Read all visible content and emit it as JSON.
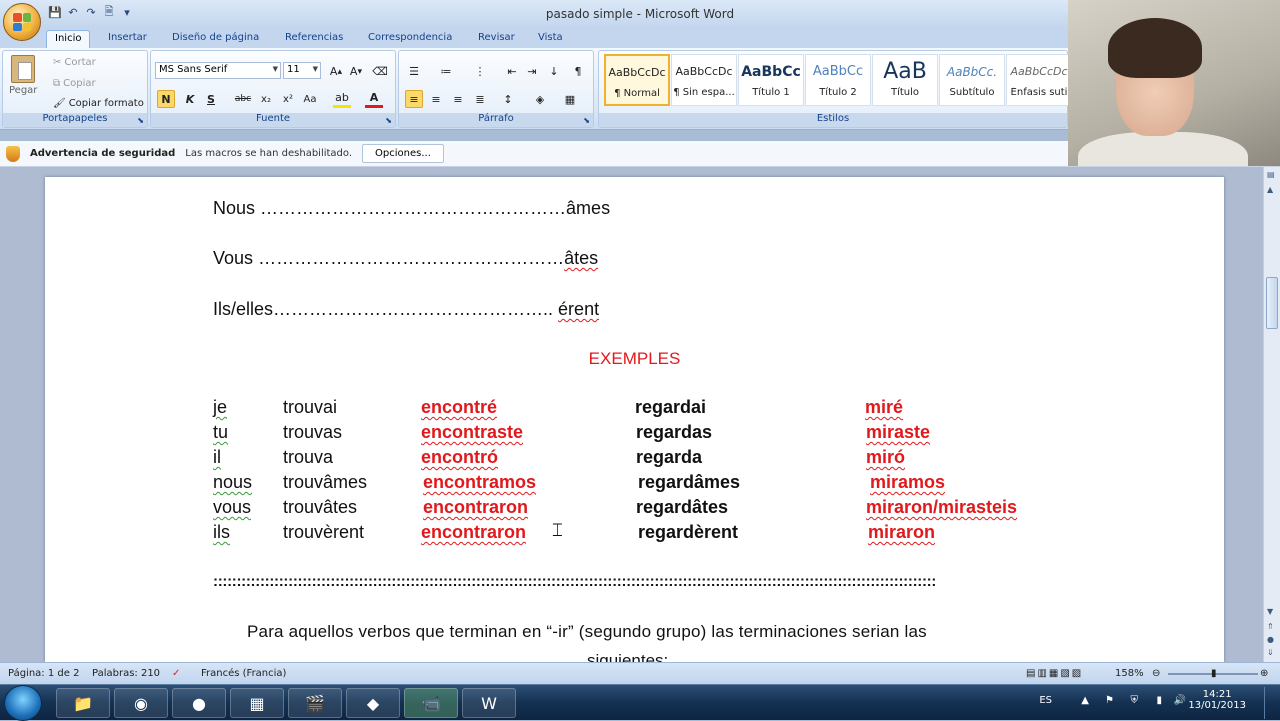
{
  "window": {
    "title": "pasado simple - Microsoft Word"
  },
  "tabs": [
    "Inicio",
    "Insertar",
    "Diseño de página",
    "Referencias",
    "Correspondencia",
    "Revisar",
    "Vista"
  ],
  "active_tab": "Inicio",
  "ribbon": {
    "clipboard": {
      "label": "Portapapeles",
      "paste": "Pegar",
      "cut": "Cortar",
      "copy": "Copiar",
      "format_painter": "Copiar formato"
    },
    "font": {
      "label": "Fuente",
      "font_name": "MS Sans Serif",
      "font_size": "11"
    },
    "paragraph": {
      "label": "Párrafo"
    },
    "styles": {
      "label": "Estilos",
      "items": [
        {
          "preview": "AaBbCcDc",
          "name": "¶ Normal"
        },
        {
          "preview": "AaBbCcDc",
          "name": "¶ Sin espa..."
        },
        {
          "preview": "AaBbCc",
          "name": "Título 1"
        },
        {
          "preview": "AaBbCc",
          "name": "Título 2"
        },
        {
          "preview": "AaB",
          "name": "Título"
        },
        {
          "preview": "AaBbCc.",
          "name": "Subtítulo"
        },
        {
          "preview": "AaBbCcDc",
          "name": "Énfasis suti"
        }
      ]
    }
  },
  "security_bar": {
    "title": "Advertencia de seguridad",
    "message": "Las macros se han deshabilitado.",
    "button": "Opciones..."
  },
  "document": {
    "lines": [
      {
        "pronoun": "Nous",
        "dots": "……………………………………………",
        "ending": "âmes"
      },
      {
        "pronoun": "Vous",
        "dots": "……………………………………………",
        "ending": "âtes"
      },
      {
        "pronoun": "Ils/elles",
        "dots": "……………………………………….. ",
        "ending": "érent"
      }
    ],
    "heading": "EXEMPLES",
    "table": [
      {
        "pronoun": "je",
        "fr1": "trouvai",
        "es1": "encontré",
        "fr2": "regardai",
        "es2": "miré"
      },
      {
        "pronoun": "tu",
        "fr1": "trouvas",
        "es1": "encontraste",
        "fr2": "regardas",
        "es2": "miraste"
      },
      {
        "pronoun": "il",
        "fr1": "trouva",
        "es1": "encontró",
        "fr2": "regarda",
        "es2": "miró"
      },
      {
        "pronoun": "nous",
        "fr1": "trouvâmes",
        "es1": "encontramos",
        "fr2": "regardâmes",
        "es2": "miramos"
      },
      {
        "pronoun": "vous",
        "fr1": "trouvâtes",
        "es1": "encontraron",
        "fr2": "regardâtes",
        "es2": "miraron/mirasteis"
      },
      {
        "pronoun": "ils",
        "fr1": "trouvèrent",
        "es1": "encontraron",
        "fr2": "regardèrent",
        "es2": "miraron"
      }
    ],
    "separator": "::::::::::::::::::::::::::::::::::::::::::::::::::::::::::::::::::::::::::::::::::::::::::::::::::::::::::::::::::::::::::::::::::::::::::::::::::::::::::",
    "paragraph": "Para aquellos verbos que terminan en “-ir” (segundo grupo) las terminaciones serian las",
    "paragraph_cut": "siguientes:"
  },
  "status": {
    "page": "Página: 1 de 2",
    "words": "Palabras: 210",
    "language": "Francés (Francia)",
    "zoom": "158%"
  },
  "taskbar": {
    "lang": "ES",
    "time": "14:21",
    "date": "13/01/2013"
  }
}
